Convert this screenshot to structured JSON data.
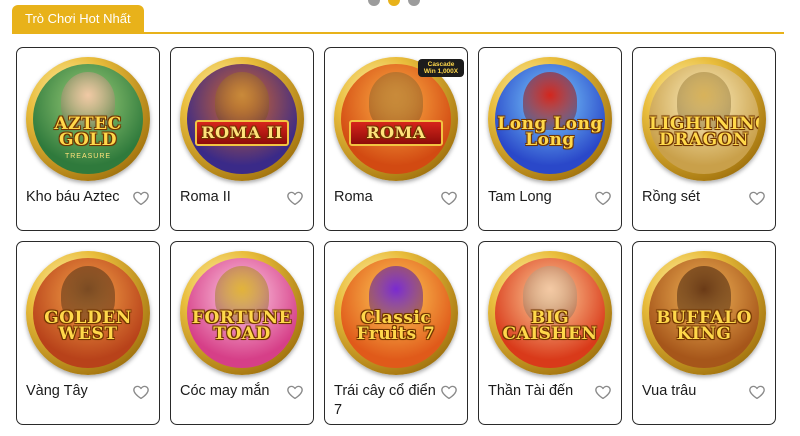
{
  "carousel": {
    "page_count": 3,
    "active_index": 1
  },
  "section": {
    "title": "Trò Chơi Hot Nhất"
  },
  "colors": {
    "accent": "#e8b21a"
  },
  "games": [
    {
      "name": "Kho báu Aztec",
      "logo_text": "AZTEC GOLD",
      "logo_subtext": "TREASURE",
      "favorite_icon": "heart-outline-icon",
      "theme": {
        "bg": "#2f7a3c",
        "bg2": "#9fd07a",
        "fig": "#f1c9a5"
      }
    },
    {
      "name": "Roma II",
      "logo_text": "ROMA II",
      "favorite_icon": "heart-outline-icon",
      "theme": {
        "bg": "#3a2a88",
        "bg2": "#d96a2a",
        "fig": "#c98a3a"
      }
    },
    {
      "name": "Roma",
      "logo_text": "ROMA",
      "badge_text": "Cascade Win 1,000X",
      "favorite_icon": "heart-outline-icon",
      "theme": {
        "bg": "#d24a12",
        "bg2": "#ffb347",
        "fig": "#c98a3a"
      }
    },
    {
      "name": "Tam Long",
      "logo_text": "Long Long Long",
      "favorite_icon": "heart-outline-icon",
      "theme": {
        "bg": "#2a48c9",
        "bg2": "#7ed3ff",
        "fig": "#d3261d"
      }
    },
    {
      "name": "Rồng sét",
      "logo_text": "LIGHTNING DRAGON",
      "favorite_icon": "heart-outline-icon",
      "theme": {
        "bg": "#c9a04a",
        "bg2": "#fff1c2",
        "fig": "#d8b25a"
      }
    },
    {
      "name": "Vàng Tây",
      "logo_text": "GOLDEN WEST",
      "favorite_icon": "heart-outline-icon",
      "theme": {
        "bg": "#b8421a",
        "bg2": "#f6a64a",
        "fig": "#7a4a22"
      }
    },
    {
      "name": "Cóc may mắn",
      "logo_text": "FORTUNE TOAD",
      "favorite_icon": "heart-outline-icon",
      "theme": {
        "bg": "#d63f88",
        "bg2": "#ffd0e6",
        "fig": "#e2b33a"
      }
    },
    {
      "name": "Trái cây cổ điển 7",
      "logo_text": "Classic Fruits 7",
      "favorite_icon": "heart-outline-icon",
      "theme": {
        "bg": "#e05a1a",
        "bg2": "#ffcf5a",
        "fig": "#7a2ad0"
      }
    },
    {
      "name": "Thần Tài đến",
      "logo_text": "BIG CAISHEN",
      "favorite_icon": "heart-outline-icon",
      "theme": {
        "bg": "#d93a1a",
        "bg2": "#ffd7a0",
        "fig": "#f4c9a4"
      }
    },
    {
      "name": "Vua trâu",
      "logo_text": "BUFFALO KING",
      "favorite_icon": "heart-outline-icon",
      "theme": {
        "bg": "#a6561a",
        "bg2": "#f5b85a",
        "fig": "#6a3a16"
      }
    }
  ]
}
